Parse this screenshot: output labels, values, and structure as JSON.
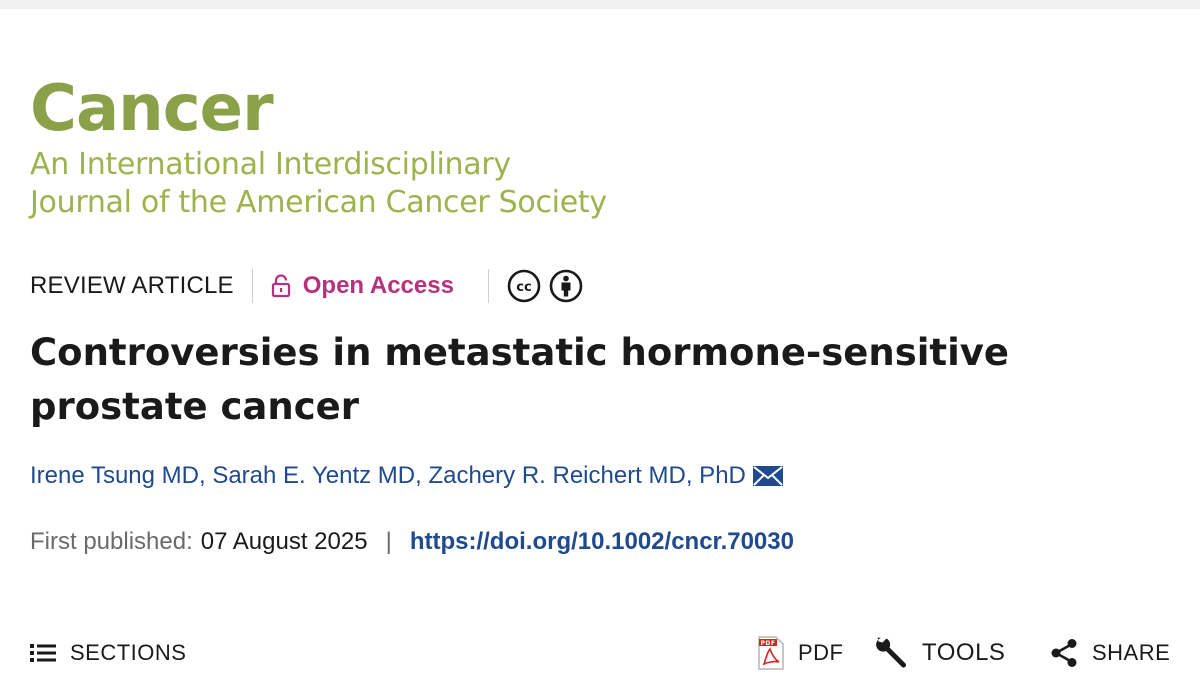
{
  "journal": {
    "name": "Cancer",
    "subtitle_line1": "An International Interdisciplinary",
    "subtitle_line2": "Journal of the American Cancer Society",
    "brand_color": "#8aa149"
  },
  "article": {
    "type": "REVIEW ARTICLE",
    "access_label": "Open Access",
    "access_color": "#b8317d",
    "license_icons": [
      "cc-icon",
      "by-attribution-icon"
    ],
    "title": "Controversies in metastatic hormone-sensitive prostate cancer",
    "authors": [
      "Irene Tsung MD",
      "Sarah E. Yentz MD",
      "Zachery R. Reichert MD, PhD"
    ],
    "author_separator": ", ",
    "published_label": "First published:",
    "published_date": "07 August 2025",
    "separator": "|",
    "doi": "https://doi.org/10.1002/cncr.70030",
    "link_color": "#1f4a8f"
  },
  "toolbar": {
    "sections_label": "SECTIONS",
    "pdf_label": "PDF",
    "tools_label": "TOOLS",
    "share_label": "SHARE"
  }
}
